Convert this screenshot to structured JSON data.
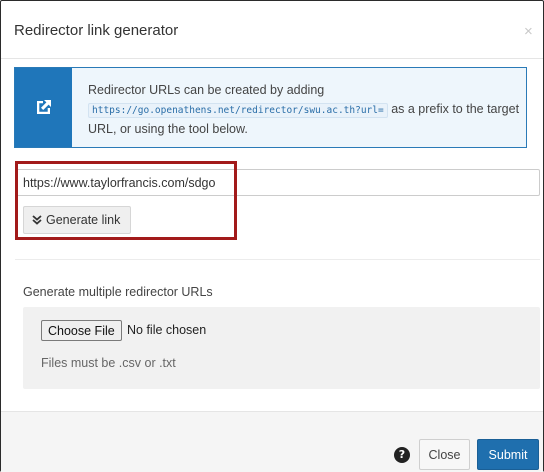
{
  "dialog": {
    "title": "Redirector link generator",
    "close_symbol": "×"
  },
  "info": {
    "icon": "external-link-icon",
    "text_before": "Redirector URLs can be created by adding",
    "prefix_code": "https://go.openathens.net/redirector/swu.ac.th?url=",
    "text_after": "as a prefix to the target URL, or using the tool below."
  },
  "single": {
    "url_value": "https://www.taylorfrancis.com/sdgo",
    "generate_icon": "double-chevron-down-icon",
    "generate_label": "Generate link"
  },
  "multiple": {
    "heading": "Generate multiple redirector URLs",
    "choose_file_label": "Choose File",
    "no_file_text": "No file chosen",
    "note": "Files must be .csv or .txt"
  },
  "footer": {
    "help_symbol": "?",
    "close_label": "Close",
    "submit_label": "Submit"
  },
  "colors": {
    "accent": "#1f76ba",
    "highlight": "#a21a1a"
  }
}
